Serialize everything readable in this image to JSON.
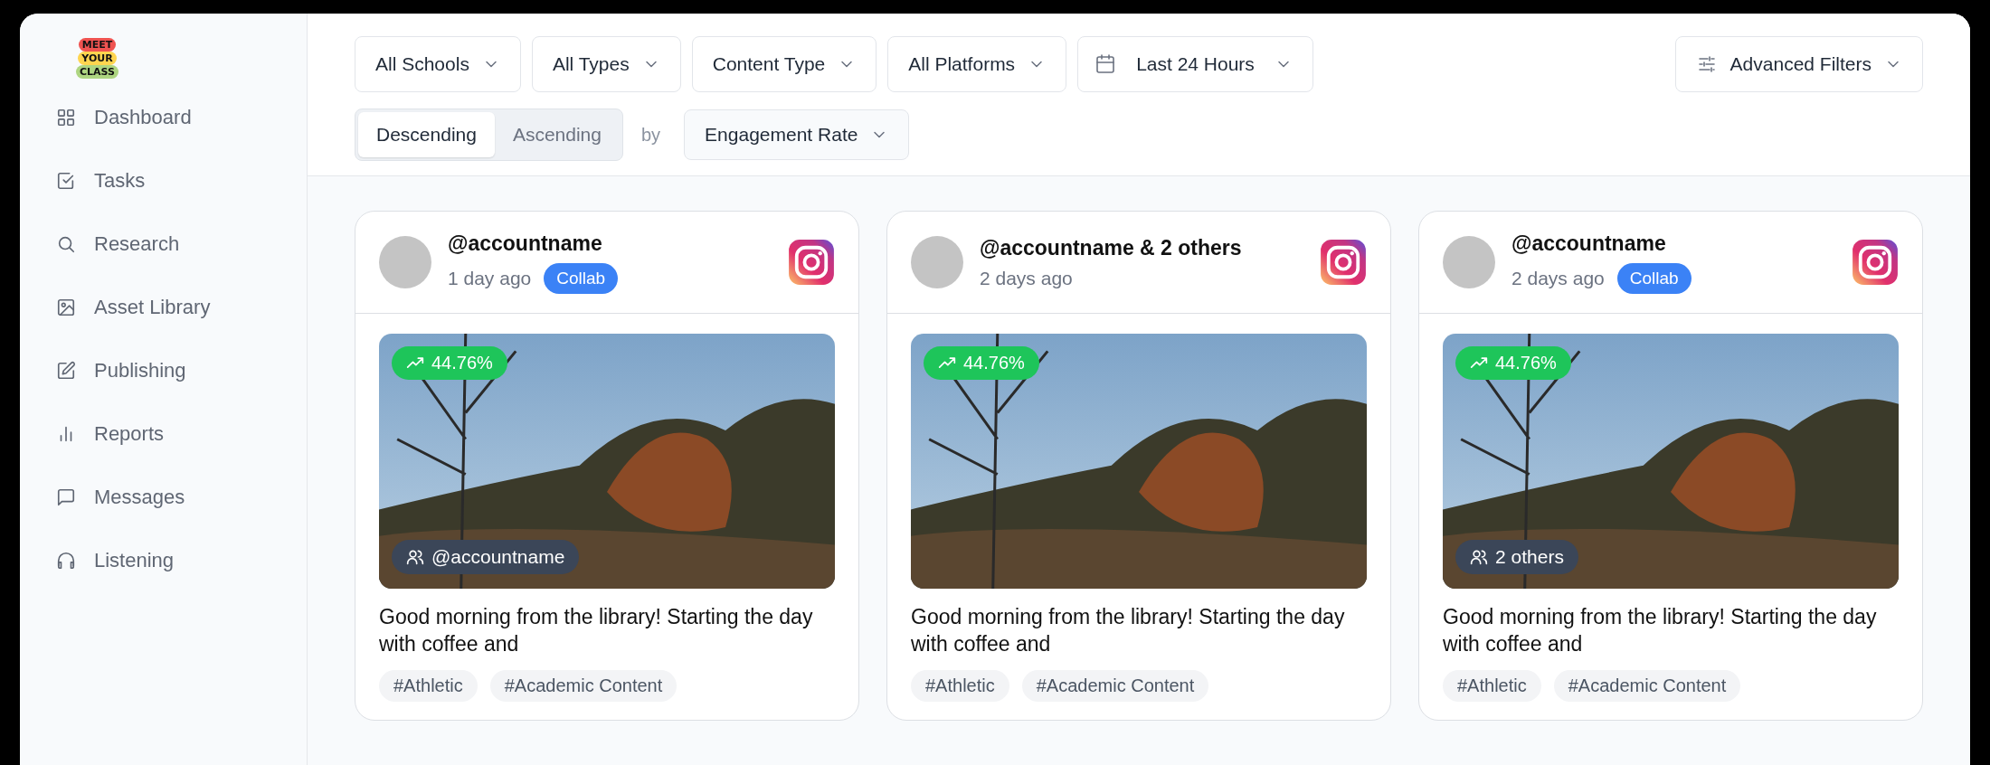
{
  "logo": {
    "lines": [
      "MEET",
      "YOUR",
      "CLASS"
    ]
  },
  "sidebar": {
    "items": [
      {
        "label": "Dashboard"
      },
      {
        "label": "Tasks"
      },
      {
        "label": "Research"
      },
      {
        "label": "Asset Library"
      },
      {
        "label": "Publishing"
      },
      {
        "label": "Reports"
      },
      {
        "label": "Messages"
      },
      {
        "label": "Listening"
      }
    ]
  },
  "filters": [
    {
      "kind": "select",
      "label": "All Schools"
    },
    {
      "kind": "select",
      "label": "All Types"
    },
    {
      "kind": "select",
      "label": "Content Type"
    },
    {
      "kind": "select",
      "label": "All Platforms"
    },
    {
      "kind": "date",
      "label": "Last 24 Hours"
    }
  ],
  "advanced_filters": {
    "label": "Advanced Filters"
  },
  "sort": {
    "options": [
      {
        "label": "Descending",
        "selected": true
      },
      {
        "label": "Ascending",
        "selected": false
      }
    ],
    "by": "by",
    "field": "Engagement Rate"
  },
  "posts": [
    {
      "account": "@accountname",
      "time": "1 day ago",
      "badge": "Collab",
      "engagement": "44.76%",
      "tagged": "@accountname",
      "caption": "Good morning from the library! Starting the day with coffee and",
      "tags": [
        "#Athletic",
        "#Academic Content"
      ]
    },
    {
      "account": "@accountname & 2 others",
      "time": "2 days ago",
      "engagement": "44.76%",
      "caption": "Good morning from the library! Starting the day with coffee and",
      "tags": [
        "#Athletic",
        "#Academic Content"
      ]
    },
    {
      "account": "@accountname",
      "time": "2 days ago",
      "badge": "Collab",
      "engagement": "44.76%",
      "tagged": "2 others",
      "caption": "Good morning from the library! Starting the day with coffee and",
      "tags": [
        "#Athletic",
        "#Academic Content"
      ]
    }
  ]
}
